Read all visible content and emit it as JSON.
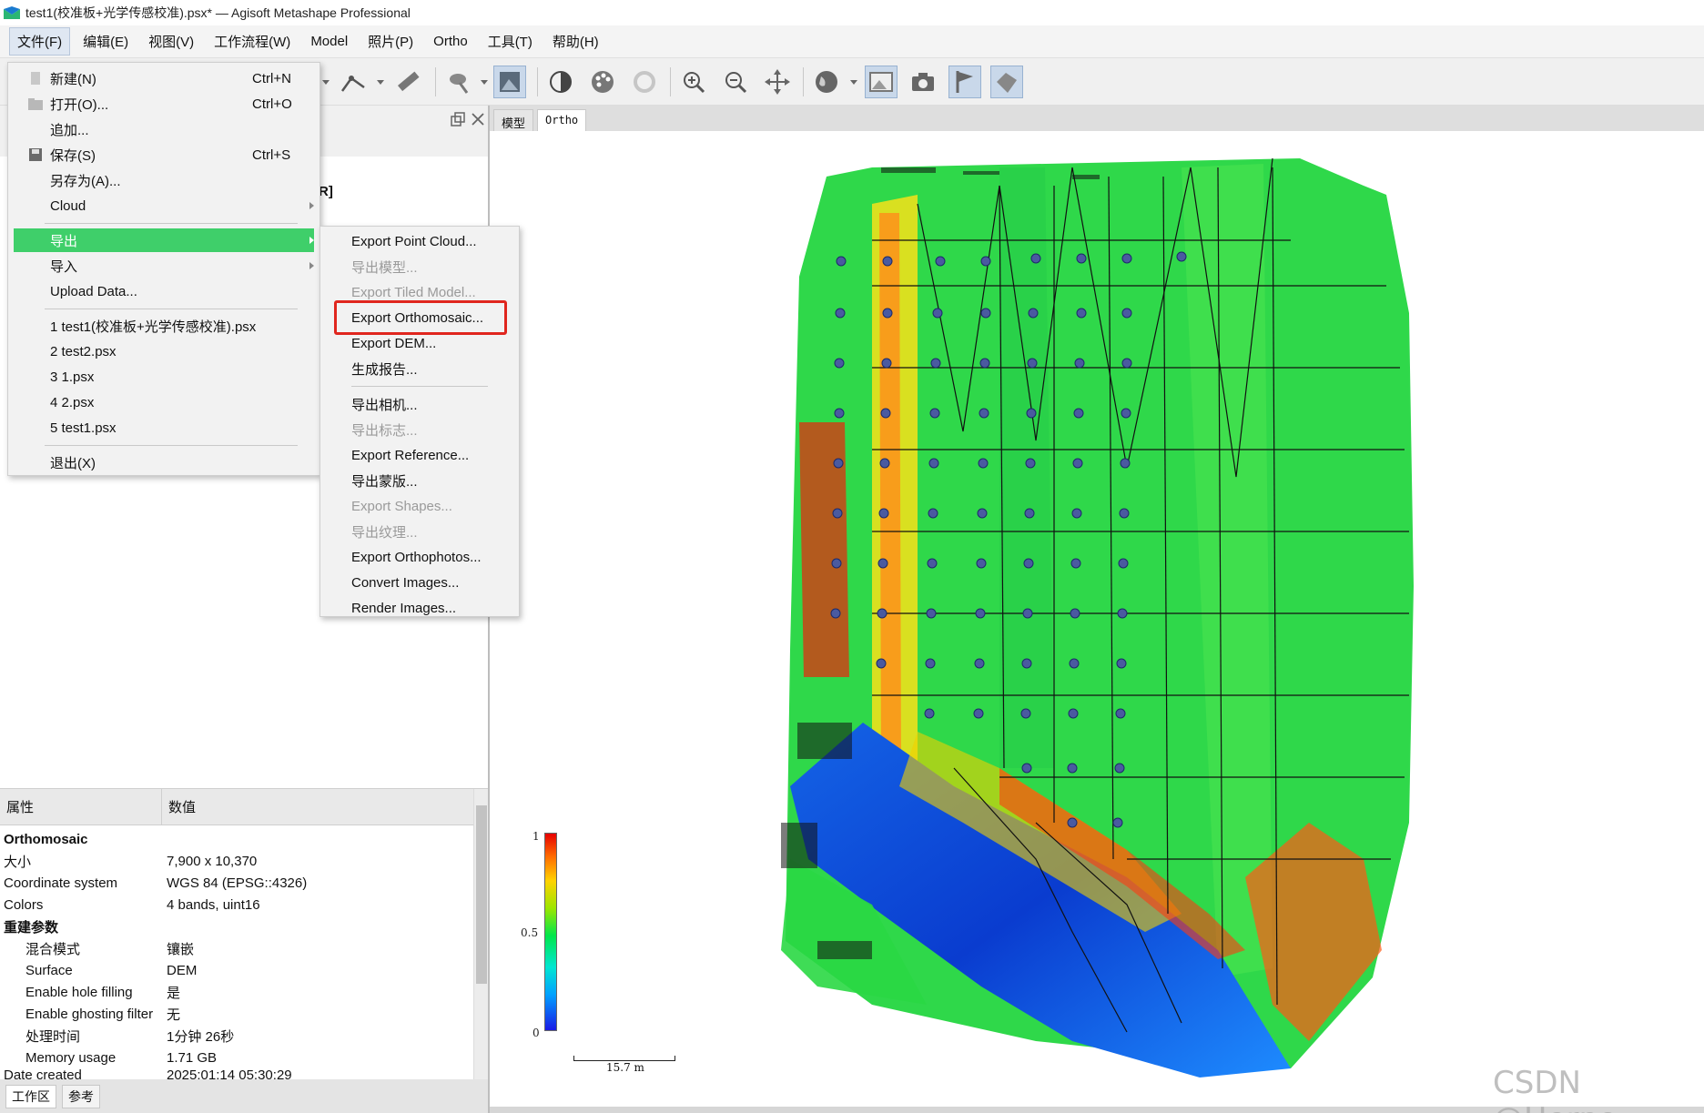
{
  "window": {
    "title": "test1(校准板+光学传感校准).psx* — Agisoft Metashape Professional"
  },
  "menubar": {
    "items": [
      "文件(F)",
      "编辑(E)",
      "视图(V)",
      "工作流程(W)",
      "Model",
      "照片(P)",
      "Ortho",
      "工具(T)",
      "帮助(H)"
    ]
  },
  "file_menu": {
    "new": {
      "label": "新建(N)",
      "shortcut": "Ctrl+N"
    },
    "open": {
      "label": "打开(O)...",
      "shortcut": "Ctrl+O"
    },
    "append": {
      "label": "追加..."
    },
    "save": {
      "label": "保存(S)",
      "shortcut": "Ctrl+S"
    },
    "save_as": {
      "label": "另存为(A)..."
    },
    "cloud": {
      "label": "Cloud"
    },
    "export": {
      "label": "导出"
    },
    "import": {
      "label": "导入"
    },
    "upload": {
      "label": "Upload Data..."
    },
    "recent": [
      "1 test1(校准板+光学传感校准).psx",
      "2 test2.psx",
      "3 1.psx",
      "4 2.psx",
      "5 test1.psx"
    ],
    "exit": {
      "label": "退出(X)"
    }
  },
  "export_menu": {
    "items": [
      {
        "label": "Export Point Cloud...",
        "enabled": true
      },
      {
        "label": "导出模型...",
        "enabled": false
      },
      {
        "label": "Export Tiled Model...",
        "enabled": false
      },
      {
        "label": "Export Orthomosaic...",
        "enabled": true
      },
      {
        "label": "Export DEM...",
        "enabled": true
      },
      {
        "label": "生成报告...",
        "enabled": true
      },
      {
        "label": "导出相机...",
        "enabled": true
      },
      {
        "label": "导出标志...",
        "enabled": false
      },
      {
        "label": "Export Reference...",
        "enabled": true
      },
      {
        "label": "导出蒙版...",
        "enabled": true
      },
      {
        "label": "Export Shapes...",
        "enabled": false
      },
      {
        "label": "导出纹理...",
        "enabled": false
      },
      {
        "label": "Export Orthophotos...",
        "enabled": true
      },
      {
        "label": "Convert Images...",
        "enabled": true
      },
      {
        "label": "Render Images...",
        "enabled": true
      }
    ]
  },
  "left_panel": {
    "clipped_text": "R]"
  },
  "properties": {
    "header": {
      "col1": "属性",
      "col2": "数值"
    },
    "rows": [
      {
        "key": "Orthomosaic",
        "value": ""
      },
      {
        "key": "大小",
        "value": "7,900 x 10,370"
      },
      {
        "key": "Coordinate system",
        "value": "WGS 84 (EPSG::4326)"
      },
      {
        "key": "Colors",
        "value": "4 bands, uint16"
      },
      {
        "key": "重建参数",
        "value": ""
      },
      {
        "key": "混合模式",
        "value": "镶嵌"
      },
      {
        "key": "Surface",
        "value": "DEM"
      },
      {
        "key": "Enable hole filling",
        "value": "是"
      },
      {
        "key": "Enable ghosting filter",
        "value": "无"
      },
      {
        "key": "处理时间",
        "value": "1分钟 26秒"
      },
      {
        "key": "Memory usage",
        "value": "1.71 GB"
      },
      {
        "key": "Date created",
        "value": "2025:01:14 05:30:29"
      }
    ]
  },
  "bottom_tabs": [
    "工作区",
    "参考"
  ],
  "view_tabs": [
    "模型",
    "Ortho"
  ],
  "legend": {
    "max": "1",
    "mid": "0.5",
    "min": "0"
  },
  "scale": {
    "label": "15.7 m"
  },
  "watermark": "CSDN @Herpo",
  "colors": {
    "highlight": "#3fcf6a",
    "callout": "#e0261e"
  }
}
